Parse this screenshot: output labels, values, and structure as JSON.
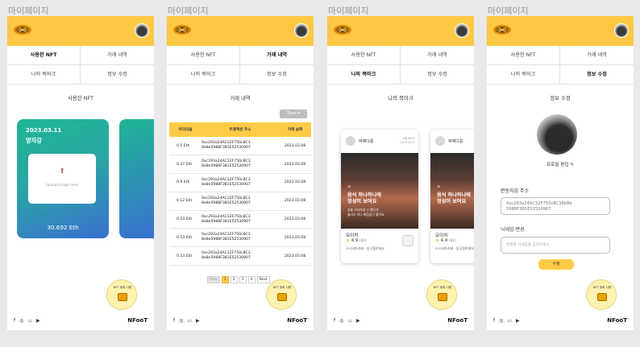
{
  "frames": [
    {
      "label": "마이페이지",
      "screen": "used-nft"
    },
    {
      "label": "마이페이지",
      "screen": "transactions"
    },
    {
      "label": "마이페이지",
      "screen": "bookmarks"
    },
    {
      "label": "마이페이지",
      "screen": "edit-profile"
    }
  ],
  "tabs": {
    "used_nft": "사용한 NFT",
    "transactions": "거래 내역",
    "bookmarks": "나의 북마크",
    "edit_info": "정보 수정"
  },
  "brand": "NFooT",
  "footer_icons": [
    "facebook-icon",
    "instagram-icon",
    "chat-icon",
    "youtube-icon"
  ],
  "nft_fab_label": "NFT 등록 사용",
  "used_nft": {
    "title": "사용한 NFT",
    "card": {
      "date": "2023.03.11",
      "name": "양자강",
      "upload_hint": "Upload image here",
      "price": "30.692 Eth"
    }
  },
  "transactions": {
    "title": "거래 내역",
    "type_button": "Type",
    "headers": [
      "이더리움",
      "트랜잭션 주소",
      "거래 날짜"
    ],
    "rows": [
      {
        "amount": "0.5 Eth",
        "addr1": "0xc293a24AC32F750c8C3",
        "addr2": "8e8e5988F381E52530907",
        "date": "2023.03.08"
      },
      {
        "amount": "0.37 Eth",
        "addr1": "0xc293a24AC32F750c8C3",
        "addr2": "8e8e5988F381E52530907",
        "date": "2023.03.08"
      },
      {
        "amount": "0.9 Eth",
        "addr1": "0xc293a24AC32F750c8C3",
        "addr2": "8e8e5988F381E52530907",
        "date": "2023.03.08"
      },
      {
        "amount": "0.12 Eth",
        "addr1": "0xc293a24AC32F750c8C3",
        "addr2": "8e8e5988F381E52530907",
        "date": "2023.03.08"
      },
      {
        "amount": "0.53 Eth",
        "addr1": "0xc293a24AC32F750c8C3",
        "addr2": "8e8e5988F381E52530907",
        "date": "2023.03.08"
      },
      {
        "amount": "0.53 Eth",
        "addr1": "0xc293a24AC32F750c8C3",
        "addr2": "8e8e5988F381E52530907",
        "date": "2023.03.08"
      },
      {
        "amount": "0.53 Eth",
        "addr1": "0xc293a24AC32F750c8C3",
        "addr2": "8e8e5988F381E52530907",
        "date": "2023.03.08"
      }
    ],
    "pager": {
      "prev": "Prev",
      "pages": [
        "1",
        "2",
        "3",
        "4"
      ],
      "active": "1",
      "next": "Next"
    }
  },
  "bookmarks": {
    "title": "나의 북마크",
    "card": {
      "author": "박예다콩",
      "meta_line1": "서울 용산구",
      "meta_line2": "2023.03.22",
      "quote": "“",
      "head1": "음식 하나하나에",
      "head2": "정성이 보여요",
      "sub1": "숯불 오마카세 고 했는데",
      "sub2": "퀄리티 하나 빠짐없이 좋아요",
      "title": "요이치",
      "rating": "4.9",
      "rating_count": "(82)",
      "address": "스시오마카세 · 압구정로데오"
    },
    "peek": {
      "author": "박예다콩",
      "head1": "음식 하나하나에",
      "head2": "정성이 보여요",
      "title": "요이치",
      "rating": "4.9",
      "rating_count": "(82)",
      "address": "스시오마카세 · 압구정로데오"
    }
  },
  "edit_profile": {
    "title": "정보 수정",
    "profile_edit_label": "프로필 편집",
    "wallet_label": "변동지갑 주소",
    "wallet_value1": "0xc293a24AC32F750c8C38e8e",
    "wallet_value2": "5988F381E52530907",
    "nickname_label": "닉네임 변경",
    "nickname_placeholder": "변경할 닉네임을 입력하세요.",
    "submit": "수정"
  },
  "colors": {
    "accent": "#ffc844",
    "table_header": "#ffcb47",
    "card_start": "#1fb694",
    "card_end": "#3a6fd1"
  }
}
